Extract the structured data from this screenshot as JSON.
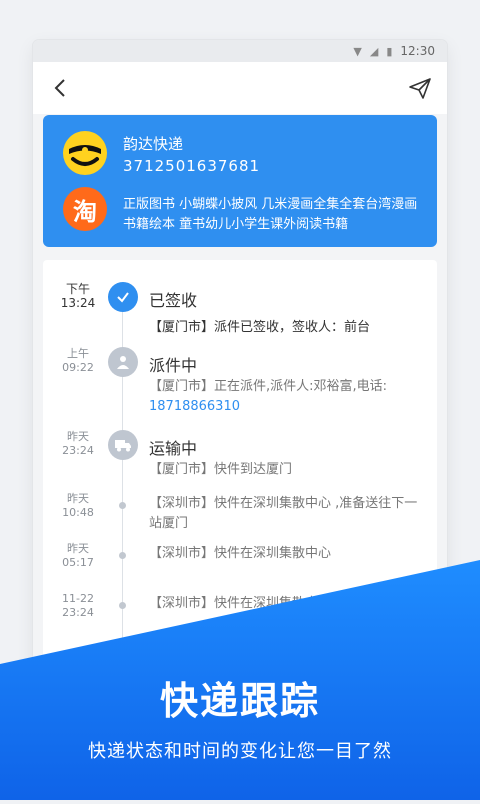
{
  "status_bar": {
    "time": "12:30"
  },
  "nav": {
    "back_icon": "chevron-left-icon",
    "share_icon": "send-icon"
  },
  "package": {
    "company": "韵达快递",
    "tracking_no": "3712501637681",
    "goods": "正版图书 小蝴蝶小披风 几米漫画全集全套台湾漫画书籍绘本 童书幼儿小学生课外阅读书籍",
    "taobao_logo_text": "淘"
  },
  "timeline": [
    {
      "date": "下午",
      "time": "13:24",
      "status": "已签收",
      "desc": "【厦门市】派件已签收，签收人：前台",
      "phone": ""
    },
    {
      "date": "上午",
      "time": "09:22",
      "status": "派件中",
      "desc": "【厦门市】正在派件,派件人:邓裕富,电话:",
      "phone": "18718866310"
    },
    {
      "date": "昨天",
      "time": "23:24",
      "status": "运输中",
      "desc": "【厦门市】快件到达厦门",
      "phone": ""
    },
    {
      "date": "昨天",
      "time": "10:48",
      "status": "",
      "desc": "【深圳市】快件在深圳集散中心 ,准备送往下一站厦门",
      "phone": ""
    },
    {
      "date": "昨天",
      "time": "05:17",
      "status": "",
      "desc": "【深圳市】快件在深圳集散中心",
      "phone": ""
    },
    {
      "date": "11-22",
      "time": "23:24",
      "status": "",
      "desc": "【深圳市】快件在深圳集散中心",
      "phone": ""
    }
  ],
  "promo": {
    "title": "快递跟踪",
    "subtitle": "快递状态和时间的变化让您一目了然"
  },
  "colors": {
    "accent": "#2f8ff0",
    "banner_top": "#1e8cff",
    "banner_bottom": "#0f63e8"
  }
}
